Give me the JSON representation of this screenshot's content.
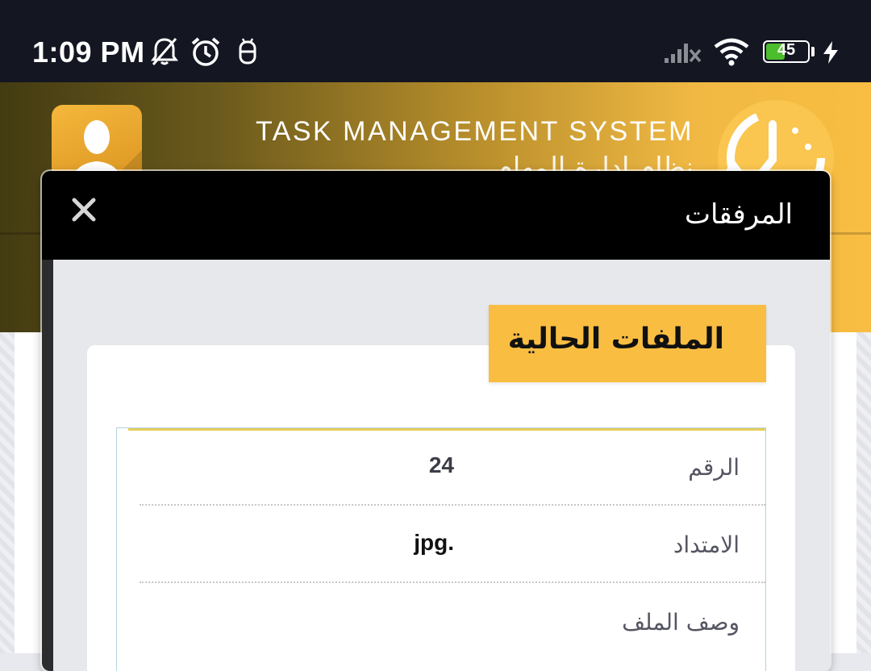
{
  "status_bar": {
    "time": "1:09 PM",
    "battery_level": "45",
    "battery_fraction": 0.45,
    "icons": [
      "bell-off-icon",
      "alarm-clock-icon",
      "usb-debug-icon",
      "signal-no-service-icon",
      "wifi-icon",
      "battery-icon",
      "charging-bolt-icon"
    ]
  },
  "header": {
    "title": "TASK MANAGEMENT SYSTEM",
    "subtitle": "نظام إدارة المهام"
  },
  "modal": {
    "title": "المرفقات",
    "close_icon": "close-icon",
    "section_title": "الملفات الحالية",
    "rows": [
      {
        "label": "الرقم",
        "value": "24"
      },
      {
        "label": "الامتداد",
        "value": "jpg."
      },
      {
        "label": "وصف الملف",
        "value": ""
      }
    ]
  },
  "colors": {
    "accent": "#f9bd42",
    "status_bar_bg": "#141622",
    "modal_header_bg": "#000000",
    "battery_green": "#4cbd2c"
  }
}
